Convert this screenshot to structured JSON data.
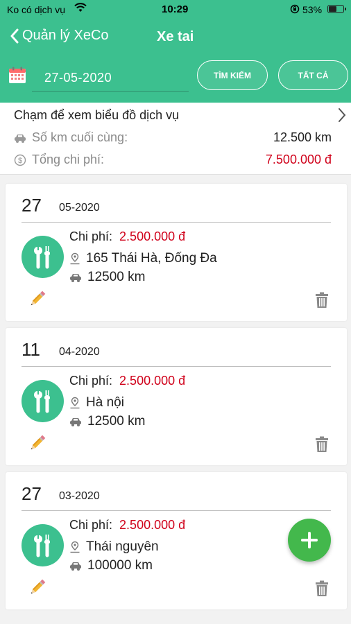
{
  "status_bar": {
    "carrier": "Ko có dịch vụ",
    "time": "10:29",
    "battery": "53%",
    "battery_level": 0.53
  },
  "nav": {
    "back_label": "Quản lý XeCo",
    "title": "Xe tai"
  },
  "filter": {
    "date_value": "27-05-2020",
    "search_label": "TÌM KIẾM",
    "all_label": "TẤT CẢ"
  },
  "summary": {
    "chart_link": "Chạm để xem biểu đồ dịch vụ",
    "last_km_label": "Số km cuối cùng:",
    "last_km_value": "12.500 km",
    "total_cost_label": "Tổng chi phí:",
    "total_cost_value": "7.500.000 đ"
  },
  "entries": [
    {
      "day": "27",
      "month_year": "05-2020",
      "cost_label": "Chi phí:",
      "cost": "2.500.000 đ",
      "place": "165 Thái Hà, Đống Đa",
      "km": "12500 km"
    },
    {
      "day": "11",
      "month_year": "04-2020",
      "cost_label": "Chi phí:",
      "cost": "2.500.000 đ",
      "place": "Hà nội",
      "km": "12500 km"
    },
    {
      "day": "27",
      "month_year": "03-2020",
      "cost_label": "Chi phí:",
      "cost": "2.500.000 đ",
      "place": "Thái nguyên",
      "km": "100000 km"
    }
  ],
  "colors": {
    "primary": "#3cc08f",
    "cost_red": "#d0021b",
    "fab_green": "#43b84c"
  },
  "icons": [
    "wifi-icon",
    "lock-rotation-icon",
    "battery-icon",
    "chevron-left-icon",
    "calendar-icon",
    "chevron-right-icon",
    "car-icon",
    "coin-icon",
    "wrench-icon",
    "location-pin-icon",
    "pencil-icon",
    "trash-icon",
    "plus-icon"
  ]
}
